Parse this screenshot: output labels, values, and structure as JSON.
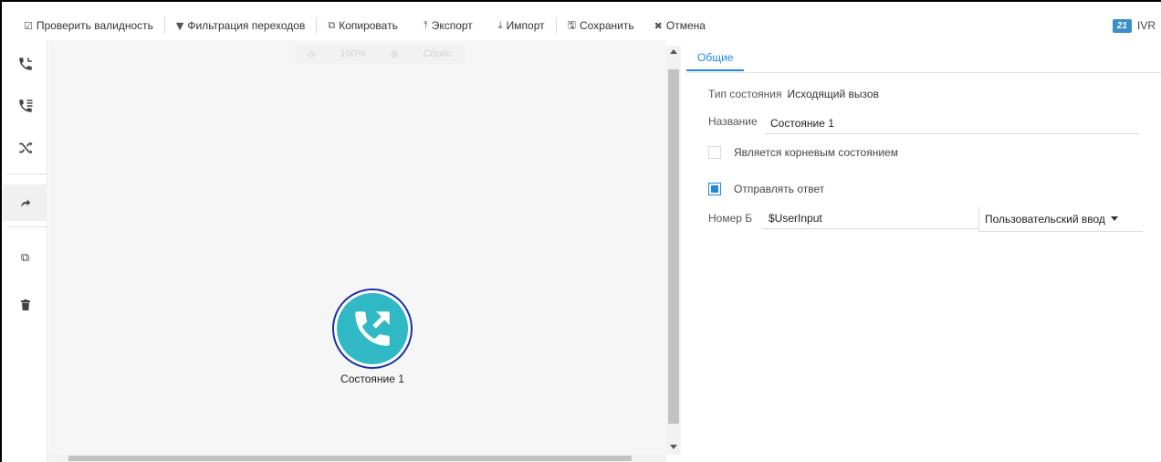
{
  "toolbar": {
    "validate": {
      "label": "Проверить валидность",
      "icon": "check-square-icon"
    },
    "filter": {
      "label": "Фильтрация переходов",
      "icon": "filter-icon"
    },
    "copy": {
      "label": "Копировать",
      "icon": "copy-icon"
    },
    "export": {
      "label": "Экспорт",
      "icon": "upload-icon"
    },
    "import": {
      "label": "Импорт",
      "icon": "download-icon"
    },
    "save": {
      "label": "Сохранить",
      "icon": "save-icon"
    },
    "cancel": {
      "label": "Отмена",
      "icon": "close-icon"
    },
    "badge": "21",
    "module": "IVR"
  },
  "rail": {
    "items": [
      {
        "name": "incoming-call-icon"
      },
      {
        "name": "call-list-icon"
      },
      {
        "name": "shuffle-icon"
      },
      {
        "name": "redirect-icon"
      },
      {
        "name": "copy-icon"
      },
      {
        "name": "trash-icon"
      }
    ]
  },
  "canvas": {
    "zoom_out": "⊖",
    "zoom_level": "100%",
    "zoom_in": "⊕",
    "reset": "Сброс",
    "node_label": "Состояние 1",
    "node_icon": "outgoing-call-icon",
    "node_color": "#31b8c5"
  },
  "panel": {
    "tab": "Общие",
    "state_type_label": "Тип состояния",
    "state_type_value": "Исходящий вызов",
    "name_label": "Название",
    "name_value": "Состояние 1",
    "root_label": "Является корневым состоянием",
    "root_checked": false,
    "send_label": "Отправлять ответ",
    "send_checked": true,
    "number_label": "Номер Б",
    "number_value": "$UserInput",
    "input_type": "Пользовательский ввод"
  },
  "colors": {
    "accent": "#1e88e5",
    "badge": "#3a8fc9",
    "node_border": "#1a2fa8"
  }
}
